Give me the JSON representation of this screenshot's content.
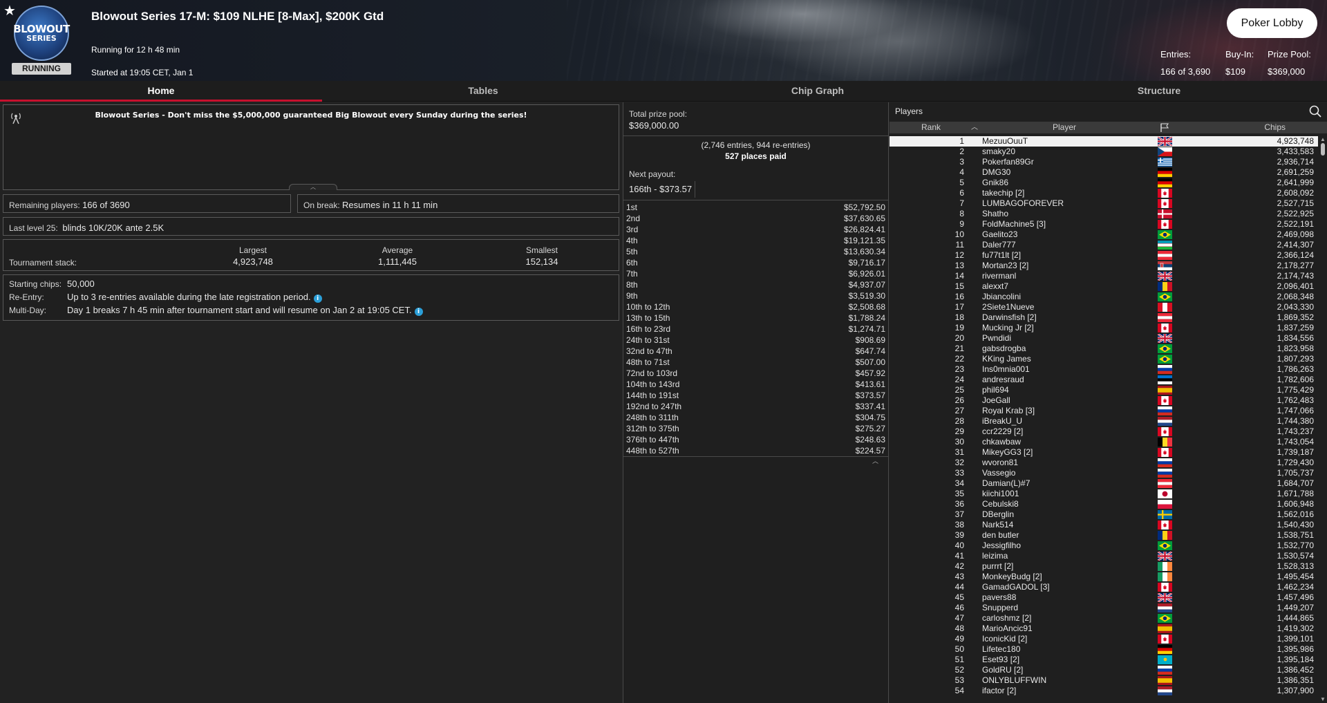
{
  "header": {
    "logo_line1": "BLOWOUT",
    "logo_line2": "SERIES",
    "status": "RUNNING",
    "title": "Blowout Series 17-M: $109 NLHE [8-Max], $200K Gtd",
    "running_for": "Running for 12 h 48 min",
    "started_at": "Started at 19:05 CET, Jan 1",
    "lobby_button": "Poker Lobby",
    "entries_label": "Entries:",
    "entries_value": "166 of 3,690",
    "buyin_label": "Buy-In:",
    "buyin_value": "$109",
    "prize_label": "Prize Pool:",
    "prize_value": "$369,000"
  },
  "tabs": [
    {
      "label": "Home",
      "active": true
    },
    {
      "label": "Tables",
      "active": false
    },
    {
      "label": "Chip Graph",
      "active": false
    },
    {
      "label": "Structure",
      "active": false
    }
  ],
  "news": {
    "message": "Blowout Series - Don't miss the $5,000,000 guaranteed Big Blowout every Sunday during the series!"
  },
  "remaining": {
    "label": "Remaining players:",
    "value": "166 of 3690"
  },
  "break": {
    "label": "On break:",
    "value": "Resumes in 11 h 11 min"
  },
  "last_level": {
    "label": "Last level 25:",
    "value": "blinds 10K/20K ante 2.5K"
  },
  "stack": {
    "label": "Tournament stack:",
    "largest_label": "Largest",
    "largest_value": "4,923,748",
    "average_label": "Average",
    "average_value": "1,111,445",
    "smallest_label": "Smallest",
    "smallest_value": "152,134"
  },
  "info": {
    "starting_label": "Starting chips:",
    "starting_value": "50,000",
    "reentry_label": "Re-Entry:",
    "reentry_value": "Up to 3 re-entries available during the late registration period.",
    "multiday_label": "Multi-Day:",
    "multiday_value": "Day 1 breaks 7 h 45 min after tournament start and will resume on Jan 2 at 19:05 CET.",
    "info_icon": "i"
  },
  "prizepool": {
    "total_label": "Total prize pool:",
    "total_value": "$369,000.00",
    "entries_note": "(2,746 entries, 944 re-entries)",
    "places_paid": "527 places paid",
    "next_label": "Next payout:",
    "next_value": "166th - $373.57"
  },
  "payouts": [
    {
      "place": "1st",
      "amount": "$52,792.50"
    },
    {
      "place": "2nd",
      "amount": "$37,630.65"
    },
    {
      "place": "3rd",
      "amount": "$26,824.41"
    },
    {
      "place": "4th",
      "amount": "$19,121.35"
    },
    {
      "place": "5th",
      "amount": "$13,630.34"
    },
    {
      "place": "6th",
      "amount": "$9,716.17"
    },
    {
      "place": "7th",
      "amount": "$6,926.01"
    },
    {
      "place": "8th",
      "amount": "$4,937.07"
    },
    {
      "place": "9th",
      "amount": "$3,519.30"
    },
    {
      "place": "10th to 12th",
      "amount": "$2,508.68"
    },
    {
      "place": "13th to 15th",
      "amount": "$1,788.24"
    },
    {
      "place": "16th to 23rd",
      "amount": "$1,274.71"
    },
    {
      "place": "24th to 31st",
      "amount": "$908.69"
    },
    {
      "place": "32nd to 47th",
      "amount": "$647.74"
    },
    {
      "place": "48th to 71st",
      "amount": "$507.00"
    },
    {
      "place": "72nd to 103rd",
      "amount": "$457.92"
    },
    {
      "place": "104th to 143rd",
      "amount": "$413.61"
    },
    {
      "place": "144th to 191st",
      "amount": "$373.57"
    },
    {
      "place": "192nd to 247th",
      "amount": "$337.41"
    },
    {
      "place": "248th to 311th",
      "amount": "$304.75"
    },
    {
      "place": "312th to 375th",
      "amount": "$275.27"
    },
    {
      "place": "376th to 447th",
      "amount": "$248.63"
    },
    {
      "place": "448th to 527th",
      "amount": "$224.57"
    }
  ],
  "players": {
    "title": "Players",
    "col_rank": "Rank",
    "col_player": "Player",
    "col_chips": "Chips",
    "rows": [
      {
        "rank": "1",
        "name": "MezuuOuuT",
        "flag": "gb",
        "chips": "4,923,748"
      },
      {
        "rank": "2",
        "name": "smaky20",
        "flag": "cz",
        "chips": "3,433,583"
      },
      {
        "rank": "3",
        "name": "Pokerfan89Gr",
        "flag": "gr",
        "chips": "2,936,714"
      },
      {
        "rank": "4",
        "name": "DMG30",
        "flag": "de",
        "chips": "2,691,259"
      },
      {
        "rank": "5",
        "name": "Gnik86",
        "flag": "de",
        "chips": "2,641,999"
      },
      {
        "rank": "6",
        "name": "takechip [2]",
        "flag": "ca",
        "chips": "2,608,092"
      },
      {
        "rank": "7",
        "name": "LUMBAGOFOREVER",
        "flag": "ca",
        "chips": "2,527,715"
      },
      {
        "rank": "8",
        "name": "Shatho",
        "flag": "dk",
        "chips": "2,522,925"
      },
      {
        "rank": "9",
        "name": "FoldMachine5 [3]",
        "flag": "ca",
        "chips": "2,522,191"
      },
      {
        "rank": "10",
        "name": "Gaelito23",
        "flag": "br",
        "chips": "2,469,098"
      },
      {
        "rank": "11",
        "name": "Daler777",
        "flag": "uz",
        "chips": "2,414,307"
      },
      {
        "rank": "12",
        "name": "fu77t1lt [2]",
        "flag": "at",
        "chips": "2,366,124"
      },
      {
        "rank": "13",
        "name": "Mortan23 [2]",
        "flag": "rs",
        "chips": "2,178,277"
      },
      {
        "rank": "14",
        "name": "rivermanl",
        "flag": "gb",
        "chips": "2,174,743"
      },
      {
        "rank": "15",
        "name": "alexxt7",
        "flag": "ro",
        "chips": "2,096,401"
      },
      {
        "rank": "16",
        "name": "Jbiancolini",
        "flag": "br",
        "chips": "2,068,348"
      },
      {
        "rank": "17",
        "name": "2Siete1Nueve",
        "flag": "pe",
        "chips": "2,043,330"
      },
      {
        "rank": "18",
        "name": "Darwinsfish [2]",
        "flag": "at",
        "chips": "1,869,352"
      },
      {
        "rank": "19",
        "name": "Mucking Jr [2]",
        "flag": "ca",
        "chips": "1,837,259"
      },
      {
        "rank": "20",
        "name": "Pwndidi",
        "flag": "gb",
        "chips": "1,834,556"
      },
      {
        "rank": "21",
        "name": "gabsdrogba",
        "flag": "br",
        "chips": "1,823,958"
      },
      {
        "rank": "22",
        "name": "KKing James",
        "flag": "br",
        "chips": "1,807,293"
      },
      {
        "rank": "23",
        "name": "Ins0mnia001",
        "flag": "ru",
        "chips": "1,786,263"
      },
      {
        "rank": "24",
        "name": "andresraud",
        "flag": "ee",
        "chips": "1,782,606"
      },
      {
        "rank": "25",
        "name": "phil694",
        "flag": "es",
        "chips": "1,775,429"
      },
      {
        "rank": "26",
        "name": "JoeGall",
        "flag": "ca",
        "chips": "1,762,483"
      },
      {
        "rank": "27",
        "name": "Royal Krab [3]",
        "flag": "ru",
        "chips": "1,747,066"
      },
      {
        "rank": "28",
        "name": "iBreakU_U",
        "flag": "nl",
        "chips": "1,744,380"
      },
      {
        "rank": "29",
        "name": "ccr2229 [2]",
        "flag": "ca",
        "chips": "1,743,237"
      },
      {
        "rank": "30",
        "name": "chkawbaw",
        "flag": "be",
        "chips": "1,743,054"
      },
      {
        "rank": "31",
        "name": "MikeyGG3 [2]",
        "flag": "ca",
        "chips": "1,739,187"
      },
      {
        "rank": "32",
        "name": "wvoron81",
        "flag": "ru",
        "chips": "1,729,430"
      },
      {
        "rank": "33",
        "name": "Vassegio",
        "flag": "ru",
        "chips": "1,705,737"
      },
      {
        "rank": "34",
        "name": "Damian(L)#7",
        "flag": "at",
        "chips": "1,684,707"
      },
      {
        "rank": "35",
        "name": "kiichi1001",
        "flag": "jp",
        "chips": "1,671,788"
      },
      {
        "rank": "36",
        "name": "Cebulski8",
        "flag": "pl",
        "chips": "1,606,948"
      },
      {
        "rank": "37",
        "name": "DBerglin",
        "flag": "se",
        "chips": "1,562,016"
      },
      {
        "rank": "38",
        "name": "Nark514",
        "flag": "ca",
        "chips": "1,540,430"
      },
      {
        "rank": "39",
        "name": "den butler",
        "flag": "ro",
        "chips": "1,538,751"
      },
      {
        "rank": "40",
        "name": "Jessigfilho",
        "flag": "br",
        "chips": "1,532,770"
      },
      {
        "rank": "41",
        "name": "leizima",
        "flag": "gb",
        "chips": "1,530,574"
      },
      {
        "rank": "42",
        "name": "purrrt [2]",
        "flag": "ie",
        "chips": "1,528,313"
      },
      {
        "rank": "43",
        "name": "MonkeyBudg [2]",
        "flag": "ie",
        "chips": "1,495,454"
      },
      {
        "rank": "44",
        "name": "GamadGADOL [3]",
        "flag": "ca",
        "chips": "1,462,234"
      },
      {
        "rank": "45",
        "name": "pavers88",
        "flag": "gb",
        "chips": "1,457,496"
      },
      {
        "rank": "46",
        "name": "Snupperd",
        "flag": "nl",
        "chips": "1,449,207"
      },
      {
        "rank": "47",
        "name": "carloshmz [2]",
        "flag": "br",
        "chips": "1,444,865"
      },
      {
        "rank": "48",
        "name": "MarioAncic91",
        "flag": "es",
        "chips": "1,419,302"
      },
      {
        "rank": "49",
        "name": "IconicKid [2]",
        "flag": "ca",
        "chips": "1,399,101"
      },
      {
        "rank": "50",
        "name": "Lifetec180",
        "flag": "de",
        "chips": "1,395,986"
      },
      {
        "rank": "51",
        "name": "Eset93 [2]",
        "flag": "kz",
        "chips": "1,395,184"
      },
      {
        "rank": "52",
        "name": "GoldRU [2]",
        "flag": "ru",
        "chips": "1,386,452"
      },
      {
        "rank": "53",
        "name": "ONLYBLUFFWIN",
        "flag": "es",
        "chips": "1,386,351"
      },
      {
        "rank": "54",
        "name": "ifactor [2]",
        "flag": "nl",
        "chips": "1,307,900"
      }
    ]
  },
  "icons": {
    "favorite": "star-icon",
    "news": "antenna-icon",
    "search": "search-icon",
    "flag_header": "flag-icon",
    "sort": "sort-ascending-icon"
  },
  "colors": {
    "accent": "#c8102e",
    "background": "#222222",
    "selected_row": "#f2f2f2"
  }
}
